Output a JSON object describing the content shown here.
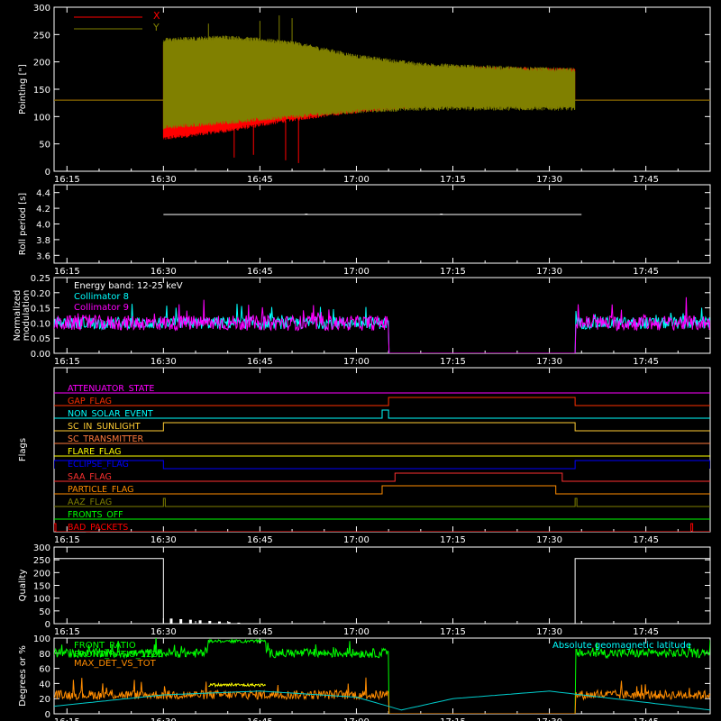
{
  "background": "#000000",
  "foreground": "#ffffff",
  "time_ticks": [
    "16:15",
    "16:30",
    "16:45",
    "17:00",
    "17:15",
    "17:30",
    "17:45"
  ],
  "chart_data": [
    {
      "id": "pointing",
      "type": "line",
      "ylabel": "Pointing [\"]",
      "ylim": [
        0,
        300
      ],
      "yticks": [
        0,
        50,
        100,
        150,
        200,
        250,
        300
      ],
      "xlim": [
        "16:13",
        "17:55"
      ],
      "legend": [
        {
          "name": "X",
          "color": "#ff0000"
        },
        {
          "name": "Y",
          "color": "#808000"
        }
      ],
      "series": [
        {
          "name": "X",
          "color": "#ff0000",
          "baseline": 130,
          "data_start": "16:30",
          "data_end": "17:34",
          "band_times": [
            "16:30",
            "16:40",
            "16:50",
            "17:00",
            "17:10",
            "17:20",
            "17:34"
          ],
          "band_low": [
            60,
            75,
            95,
            110,
            120,
            125,
            130
          ],
          "band_high": [
            230,
            210,
            200,
            195,
            190,
            188,
            185
          ],
          "spikes": [
            {
              "t": "16:41",
              "v": 25
            },
            {
              "t": "16:44",
              "v": 30
            },
            {
              "t": "16:49",
              "v": 20
            },
            {
              "t": "16:51",
              "v": 15
            }
          ]
        },
        {
          "name": "Y",
          "color": "#808000",
          "baseline": 130,
          "data_start": "16:30",
          "data_end": "17:34",
          "band_times": [
            "16:30",
            "16:40",
            "16:50",
            "17:00",
            "17:10",
            "17:20",
            "17:34"
          ],
          "band_low": [
            80,
            90,
            100,
            110,
            115,
            115,
            115
          ],
          "band_high": [
            240,
            245,
            235,
            210,
            195,
            190,
            185
          ],
          "spikes": [
            {
              "t": "16:37",
              "v": 270
            },
            {
              "t": "16:45",
              "v": 275
            },
            {
              "t": "16:48",
              "v": 285
            },
            {
              "t": "16:50",
              "v": 280
            }
          ]
        }
      ]
    },
    {
      "id": "roll",
      "type": "line",
      "ylabel": "Roll period [s]",
      "ylim": [
        3.5,
        4.5
      ],
      "yticks": [
        3.6,
        3.8,
        4.0,
        4.2,
        4.4
      ],
      "xlim": [
        "16:13",
        "17:55"
      ],
      "series": [
        {
          "name": "roll",
          "color": "#ffffff",
          "start": "16:30",
          "end": "17:35",
          "value": 4.12
        }
      ]
    },
    {
      "id": "modulation",
      "type": "line",
      "ylabel": "Normalized modulation",
      "ylim": [
        0,
        0.25
      ],
      "yticks": [
        0.0,
        0.05,
        0.1,
        0.15,
        0.2,
        0.25
      ],
      "xlim": [
        "16:13",
        "17:55"
      ],
      "annotations": [
        "Energy band: 12-25 keV"
      ],
      "legend": [
        {
          "name": "Collimator 8",
          "color": "#00ffff"
        },
        {
          "name": "Collimator 9",
          "color": "#ff00ff"
        }
      ],
      "series": [
        {
          "name": "Collimator 8",
          "color": "#00ffff",
          "mean": 0.1,
          "noise": 0.02,
          "on_intervals": [
            [
              "16:13",
              "17:05"
            ],
            [
              "17:34",
              "17:55"
            ]
          ]
        },
        {
          "name": "Collimator 9",
          "color": "#ff00ff",
          "mean": 0.1,
          "noise": 0.025,
          "on_intervals": [
            [
              "16:13",
              "17:05"
            ],
            [
              "17:34",
              "17:55"
            ]
          ]
        }
      ]
    },
    {
      "id": "flags",
      "type": "line",
      "ylabel": "Flags",
      "xlim": [
        "16:13",
        "17:55"
      ],
      "flags": [
        {
          "name": "ATTENUATOR_STATE",
          "color": "#ff00ff",
          "high_intervals": []
        },
        {
          "name": "GAP_FLAG",
          "color": "#ff3000",
          "high_intervals": [
            [
              "17:05",
              "17:34"
            ]
          ]
        },
        {
          "name": "NON_SOLAR_EVENT",
          "color": "#00ffff",
          "high_intervals": [
            [
              "17:04",
              "17:05"
            ]
          ]
        },
        {
          "name": "SC_IN_SUNLIGHT",
          "color": "#ffcc33",
          "high_intervals": [
            [
              "16:30",
              "17:34"
            ]
          ]
        },
        {
          "name": "SC_TRANSMITTER",
          "color": "#ff7a3c",
          "high_intervals": []
        },
        {
          "name": "FLARE_FLAG",
          "color": "#ffff00",
          "high_intervals": []
        },
        {
          "name": "ECLIPSE_FLAG",
          "color": "#0000ff",
          "high_intervals": [
            [
              "16:13",
              "16:30"
            ],
            [
              "17:34",
              "17:55"
            ]
          ]
        },
        {
          "name": "SAA_FLAG",
          "color": "#ff3030",
          "high_intervals": [
            [
              "17:06",
              "17:32"
            ]
          ]
        },
        {
          "name": "PARTICLE_FLAG",
          "color": "#ff8c00",
          "high_intervals": [
            [
              "17:04",
              "17:31"
            ]
          ]
        },
        {
          "name": "AAZ_FLAG",
          "color": "#808000",
          "high_intervals": [
            [
              "16:30",
              "16:30"
            ],
            [
              "17:34",
              "17:34"
            ]
          ]
        },
        {
          "name": "FRONTS_OFF",
          "color": "#00ff00",
          "high_intervals": []
        },
        {
          "name": "BAD_PACKETS",
          "color": "#ff0000",
          "high_intervals": [
            [
              "16:13",
              "16:13"
            ],
            [
              "17:52",
              "17:52"
            ]
          ]
        }
      ]
    },
    {
      "id": "quality",
      "type": "line",
      "ylabel": "Quality",
      "ylim": [
        0,
        300
      ],
      "yticks": [
        0,
        50,
        100,
        150,
        200,
        250,
        300
      ],
      "xlim": [
        "16:13",
        "17:55"
      ],
      "series": [
        {
          "name": "quality",
          "color": "#ffffff",
          "high_intervals": [
            [
              "16:13",
              "16:30"
            ],
            [
              "17:34",
              "17:55"
            ]
          ],
          "high_value": 255
        }
      ]
    },
    {
      "id": "ratios",
      "type": "line",
      "ylabel": "Degrees or %",
      "ylim": [
        0,
        100
      ],
      "yticks": [
        0,
        20,
        40,
        60,
        80,
        100
      ],
      "xlim": [
        "16:13",
        "17:55"
      ],
      "legend": [
        {
          "name": "FRONT_RATIO",
          "color": "#00ff00"
        },
        {
          "name": "FRONT_RATIO_1225",
          "color": "#00ff00"
        },
        {
          "name": "MAX_DET_VS_TOT",
          "color": "#ff8c00"
        }
      ],
      "annotations": [
        "Absolute geomagnetic latitude"
      ],
      "series": [
        {
          "name": "FRONT_RATIO",
          "color": "#00ff00",
          "mean": 80,
          "noise": 6,
          "on_intervals": [
            [
              "16:13",
              "17:05"
            ],
            [
              "17:34",
              "17:55"
            ]
          ],
          "bump": {
            "start": "16:37",
            "end": "16:46",
            "value": 96
          }
        },
        {
          "name": "MAX_DET_VS_TOT",
          "color": "#ff8c00",
          "mean": 25,
          "noise": 6,
          "on_intervals": [
            [
              "16:13",
              "17:05"
            ],
            [
              "17:34",
              "17:55"
            ]
          ]
        },
        {
          "name": "yellow_segment",
          "color": "#ffff00",
          "mean": 38,
          "noise": 2,
          "on_intervals": [
            [
              "16:37",
              "16:46"
            ]
          ]
        },
        {
          "name": "Absolute geomagnetic latitude",
          "color": "#00cccc",
          "curve_times": [
            "16:13",
            "16:30",
            "16:45",
            "17:00",
            "17:07",
            "17:15",
            "17:30",
            "17:40",
            "17:55"
          ],
          "curve_values": [
            10,
            25,
            30,
            22,
            5,
            20,
            30,
            20,
            5
          ]
        }
      ]
    }
  ]
}
